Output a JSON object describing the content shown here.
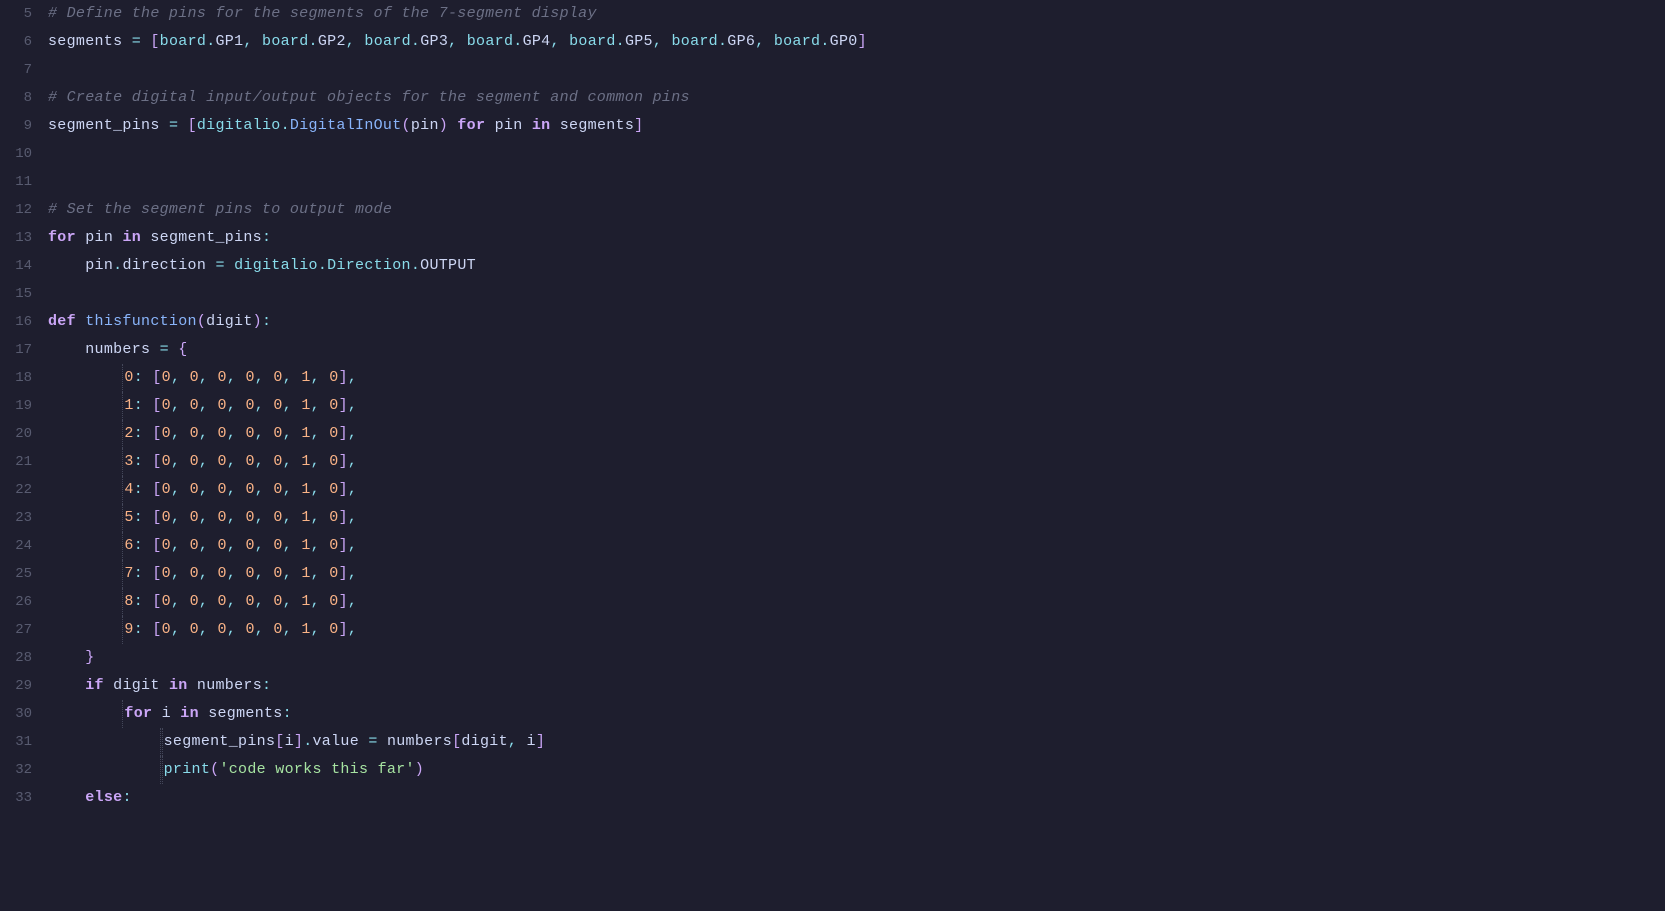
{
  "editor": {
    "background": "#1e1e2e",
    "lines": [
      {
        "num": 5,
        "content": "# Define the pins for the segments of the 7-segment display",
        "type": "comment"
      },
      {
        "num": 6,
        "content": "segments = [board.GP1, board.GP2, board.GP3, board.GP4, board.GP5, board.GP6, board.GP0]",
        "type": "code"
      },
      {
        "num": 7,
        "content": "",
        "type": "empty"
      },
      {
        "num": 8,
        "content": "# Create digital input/output objects for the segment and common pins",
        "type": "comment"
      },
      {
        "num": 9,
        "content": "segment_pins = [digitalio.DigitalInOut(pin) for pin in segments]",
        "type": "code"
      },
      {
        "num": 10,
        "content": "",
        "type": "empty"
      },
      {
        "num": 11,
        "content": "",
        "type": "empty"
      },
      {
        "num": 12,
        "content": "# Set the segment pins to output mode",
        "type": "comment"
      },
      {
        "num": 13,
        "content": "for pin in segment_pins:",
        "type": "code"
      },
      {
        "num": 14,
        "content": "    pin.direction = digitalio.Direction.OUTPUT",
        "type": "code"
      },
      {
        "num": 15,
        "content": "",
        "type": "empty"
      },
      {
        "num": 16,
        "content": "def thisfunction(digit):",
        "type": "code"
      },
      {
        "num": 17,
        "content": "    numbers = {",
        "type": "code"
      },
      {
        "num": 18,
        "content": "        0: [0, 0, 0, 0, 0, 1, 0],",
        "type": "code"
      },
      {
        "num": 19,
        "content": "        1: [0, 0, 0, 0, 0, 1, 0],",
        "type": "code"
      },
      {
        "num": 20,
        "content": "        2: [0, 0, 0, 0, 0, 1, 0],",
        "type": "code"
      },
      {
        "num": 21,
        "content": "        3: [0, 0, 0, 0, 0, 1, 0],",
        "type": "code"
      },
      {
        "num": 22,
        "content": "        4: [0, 0, 0, 0, 0, 1, 0],",
        "type": "code"
      },
      {
        "num": 23,
        "content": "        5: [0, 0, 0, 0, 0, 1, 0],",
        "type": "code"
      },
      {
        "num": 24,
        "content": "        6: [0, 0, 0, 0, 0, 1, 0],",
        "type": "code"
      },
      {
        "num": 25,
        "content": "        7: [0, 0, 0, 0, 0, 1, 0],",
        "type": "code"
      },
      {
        "num": 26,
        "content": "        8: [0, 0, 0, 0, 0, 1, 0],",
        "type": "code"
      },
      {
        "num": 27,
        "content": "        9: [0, 0, 0, 0, 0, 1, 0],",
        "type": "code"
      },
      {
        "num": 28,
        "content": "    }",
        "type": "code"
      },
      {
        "num": 29,
        "content": "    if digit in numbers:",
        "type": "code"
      },
      {
        "num": 30,
        "content": "        for i in segments:",
        "type": "code"
      },
      {
        "num": 31,
        "content": "            segment_pins[i].value = numbers[digit, i]",
        "type": "code"
      },
      {
        "num": 32,
        "content": "            print('code works this far')",
        "type": "code"
      },
      {
        "num": 33,
        "content": "    else:",
        "type": "code"
      }
    ]
  }
}
